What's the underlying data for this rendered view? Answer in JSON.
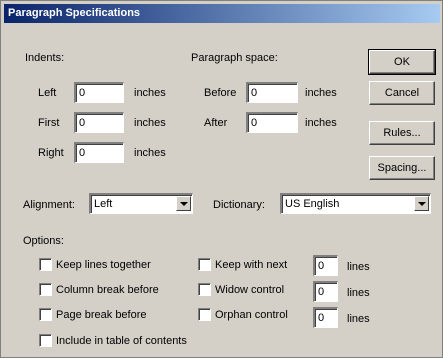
{
  "dialog": {
    "title": "Paragraph Specifications",
    "buttons": {
      "ok": "OK",
      "cancel": "Cancel",
      "rules": "Rules...",
      "spacing": "Spacing..."
    }
  },
  "indents": {
    "heading": "Indents:",
    "left": {
      "label": "Left",
      "value": "0",
      "unit": "inches"
    },
    "first": {
      "label": "First",
      "value": "0",
      "unit": "inches"
    },
    "right": {
      "label": "Right",
      "value": "0",
      "unit": "inches"
    }
  },
  "paragraph_space": {
    "heading": "Paragraph space:",
    "before": {
      "label": "Before",
      "value": "0",
      "unit": "inches"
    },
    "after": {
      "label": "After",
      "value": "0",
      "unit": "inches"
    }
  },
  "alignment": {
    "label": "Alignment:",
    "value": "Left"
  },
  "dictionary": {
    "label": "Dictionary:",
    "value": "US English"
  },
  "options": {
    "heading": "Options:",
    "keep_lines_together": "Keep lines together",
    "column_break_before": "Column break before",
    "page_break_before": "Page break before",
    "include_in_toc": "Include in table of contents",
    "keep_with_next": {
      "label": "Keep with next",
      "value": "0",
      "unit": "lines"
    },
    "widow_control": {
      "label": "Widow control",
      "value": "0",
      "unit": "lines"
    },
    "orphan_control": {
      "label": "Orphan control",
      "value": "0",
      "unit": "lines"
    }
  }
}
